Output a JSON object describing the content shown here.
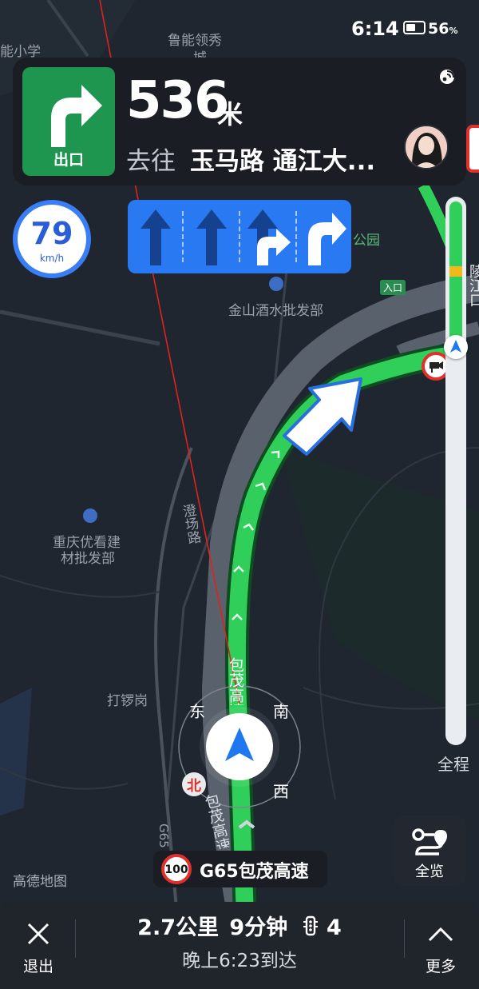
{
  "status_bar": {
    "time": "6:14",
    "battery_pct": "56",
    "battery_unit": "%",
    "battery_level": 0.56
  },
  "guidance": {
    "turn_icon": "turn-right-arrow-icon",
    "turn_label": "出口",
    "distance": "536",
    "distance_unit": "米",
    "heading_prefix": "去往",
    "heading_road": "玉马路 通江大..."
  },
  "speed": {
    "value": "79",
    "unit": "km/h"
  },
  "lanes": [
    {
      "glyphs": [
        "arrow-straight-icon"
      ],
      "active": false
    },
    {
      "glyphs": [
        "arrow-straight-icon"
      ],
      "active": false
    },
    {
      "glyphs": [
        "arrow-straight-icon",
        "arrow-right-icon"
      ],
      "active": true
    },
    {
      "glyphs": [
        "arrow-right-icon"
      ],
      "active": true
    }
  ],
  "map_labels": {
    "top_1": "能小学",
    "top_2": "鲁能领秀",
    "top_3": "城",
    "park": "公园",
    "entrance": "入口",
    "wholesale_1": "金山酒水批发部",
    "wholesale_2_line1": "重庆优看建",
    "wholesale_2_line2": "材批发部",
    "road_changchang": "澄场路",
    "place_dagang": "打锣岗",
    "road_baomao_1": "包茂高速",
    "road_baomao_2": "包茂高速",
    "road_g65": "G65",
    "road_green_right": "陵江口",
    "compass_east": "东",
    "compass_south": "南",
    "compass_west": "西",
    "compass_north": "北"
  },
  "route_progress": {
    "label": "全程",
    "remaining_fraction": 0.27,
    "segments": [
      {
        "color": "#2fcf5a",
        "fraction": 0.12
      },
      {
        "color": "#f2b81c",
        "fraction": 0.02
      },
      {
        "color": "#2fcf5a",
        "fraction": 0.13
      }
    ]
  },
  "overview_button": {
    "label": "全览",
    "icon": "route-overview-icon"
  },
  "current_road": {
    "speed_limit": "100",
    "name": "G65包茂高速"
  },
  "watermark": "高德地图",
  "trip": {
    "distance": "2.7公里",
    "duration": "9分钟",
    "traffic_lights": "4",
    "arrival": "晚上6:23到达"
  },
  "bottom_bar": {
    "exit_label": "退出",
    "more_label": "更多"
  },
  "colors": {
    "map_bg": "#1f2630",
    "route_green": "#2fcf5a",
    "lane_blue": "#2979f2",
    "turn_green": "#1e9650",
    "speed_limit_red": "#e0302b"
  }
}
